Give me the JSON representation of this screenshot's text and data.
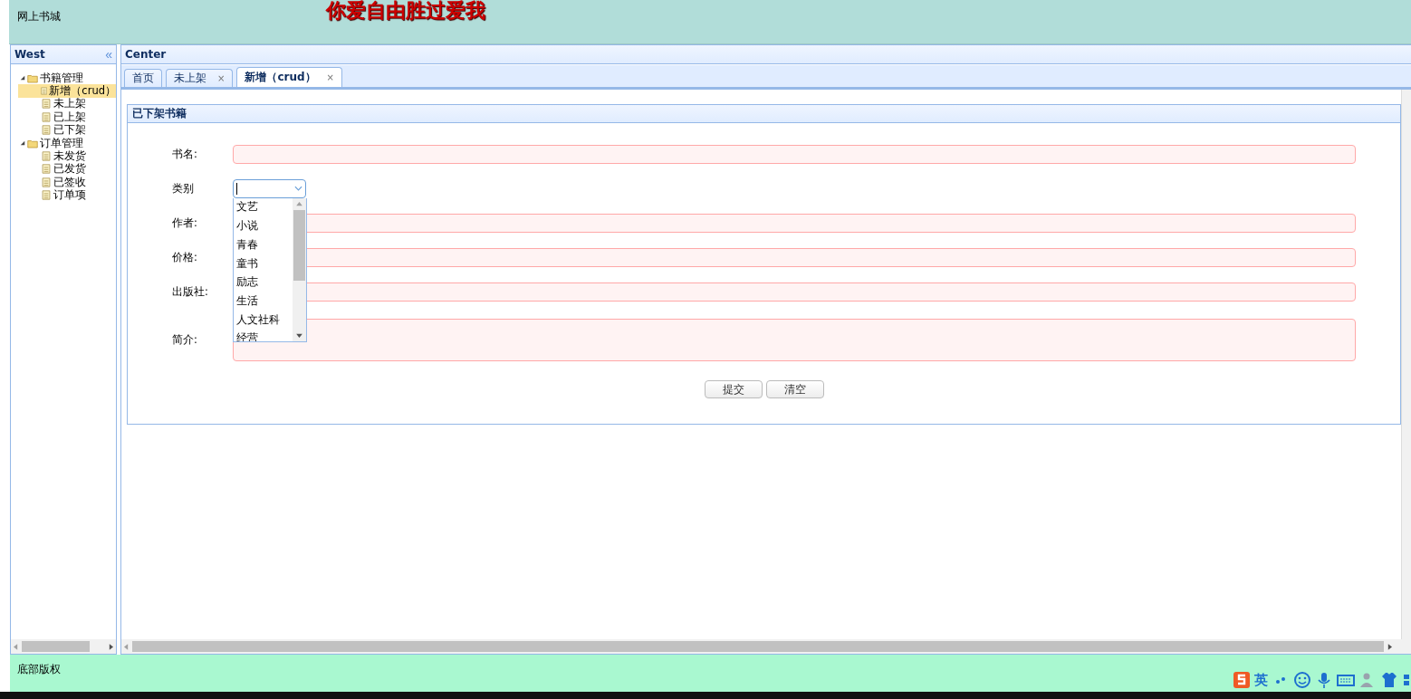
{
  "header": {
    "title": "网上书城",
    "banner": "你爱自由胜过爱我"
  },
  "west": {
    "title": "West",
    "collapse_glyph": "«",
    "tree": [
      {
        "label": "书籍管理",
        "expanded": true,
        "selected": false,
        "children": [
          {
            "label": "新增（crud）",
            "selected": true
          },
          {
            "label": "未上架",
            "selected": false
          },
          {
            "label": "已上架",
            "selected": false
          },
          {
            "label": "已下架",
            "selected": false
          }
        ]
      },
      {
        "label": "订单管理",
        "expanded": true,
        "selected": false,
        "children": [
          {
            "label": "未发货",
            "selected": false
          },
          {
            "label": "已发货",
            "selected": false
          },
          {
            "label": "已签收",
            "selected": false
          },
          {
            "label": "订单项",
            "selected": false
          }
        ]
      }
    ]
  },
  "center": {
    "title": "Center",
    "tabs": [
      {
        "label": "首页",
        "selected": false,
        "closable": false
      },
      {
        "label": "未上架",
        "selected": false,
        "closable": true
      },
      {
        "label": "新增（crud）",
        "selected": true,
        "closable": true
      }
    ],
    "close_glyph": "×",
    "panel": {
      "title": "已下架书籍",
      "fields": [
        {
          "kind": "text",
          "label": "书名:"
        },
        {
          "kind": "combo",
          "label": "类别"
        },
        {
          "kind": "text",
          "label": "作者:"
        },
        {
          "kind": "text",
          "label": "价格:"
        },
        {
          "kind": "text",
          "label": "出版社:"
        },
        {
          "kind": "textarea",
          "label": "简介:"
        }
      ],
      "dropdown": [
        "文艺",
        "小说",
        "青春",
        "童书",
        "励志",
        "生活",
        "人文社科",
        "经营"
      ],
      "buttons": [
        "提交",
        "清空"
      ]
    }
  },
  "footer": {
    "text": "底部版权"
  },
  "ime": {
    "label": "英"
  }
}
